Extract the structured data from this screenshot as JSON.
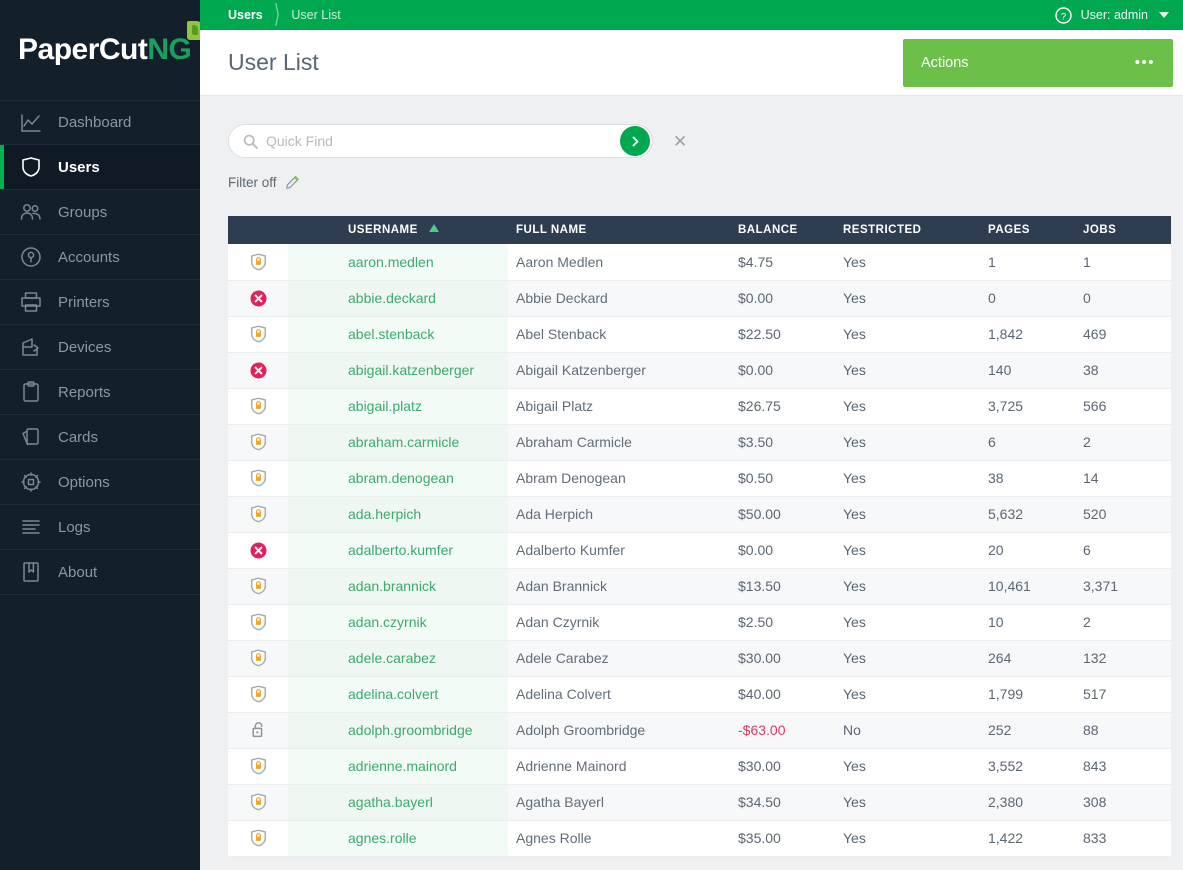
{
  "brand": {
    "name_primary": "PaperCut",
    "name_suffix": "NG",
    "accent_green": "#00a94f",
    "sidebar_bg": "#141f2c"
  },
  "sidebar": {
    "items": [
      {
        "label": "Dashboard",
        "icon": "chart-line-icon",
        "active": false
      },
      {
        "label": "Users",
        "icon": "shield-icon",
        "active": true
      },
      {
        "label": "Groups",
        "icon": "people-icon",
        "active": false
      },
      {
        "label": "Accounts",
        "icon": "lock-circle-icon",
        "active": false
      },
      {
        "label": "Printers",
        "icon": "printer-icon",
        "active": false
      },
      {
        "label": "Devices",
        "icon": "device-icon",
        "active": false
      },
      {
        "label": "Reports",
        "icon": "clipboard-icon",
        "active": false
      },
      {
        "label": "Cards",
        "icon": "cards-icon",
        "active": false
      },
      {
        "label": "Options",
        "icon": "gear-icon",
        "active": false
      },
      {
        "label": "Logs",
        "icon": "lines-icon",
        "active": false
      },
      {
        "label": "About",
        "icon": "book-icon",
        "active": false
      }
    ]
  },
  "topbar": {
    "breadcrumb_current": "Users",
    "breadcrumb_sub": "User List",
    "help_icon": "help-circle-icon",
    "user_label": "User: admin",
    "caret_icon": "chevron-down-icon"
  },
  "header": {
    "page_title": "User List",
    "actions_label": "Actions",
    "actions_dots": "•••",
    "actions_color": "#6cc04a"
  },
  "search": {
    "placeholder": "Quick Find",
    "value": "",
    "go_icon": "chevron-right-icon",
    "clear_icon": "close-icon",
    "filter_label": "Filter off",
    "filter_edit_icon": "pencil-icon"
  },
  "table": {
    "columns": [
      {
        "key": "status",
        "label": ""
      },
      {
        "key": "username",
        "label": "USERNAME",
        "sorted": "asc"
      },
      {
        "key": "fullname",
        "label": "FULL NAME"
      },
      {
        "key": "balance",
        "label": "BALANCE"
      },
      {
        "key": "restricted",
        "label": "RESTRICTED"
      },
      {
        "key": "pages",
        "label": "PAGES"
      },
      {
        "key": "jobs",
        "label": "JOBS"
      }
    ],
    "rows": [
      {
        "status": "shield-lock-icon",
        "username": "aaron.medlen",
        "fullname": "Aaron Medlen",
        "balance": "$4.75",
        "balance_negative": false,
        "restricted": "Yes",
        "pages": "1",
        "jobs": "1"
      },
      {
        "status": "error-circle-icon",
        "username": "abbie.deckard",
        "fullname": "Abbie Deckard",
        "balance": "$0.00",
        "balance_negative": false,
        "restricted": "Yes",
        "pages": "0",
        "jobs": "0"
      },
      {
        "status": "shield-lock-icon",
        "username": "abel.stenback",
        "fullname": "Abel Stenback",
        "balance": "$22.50",
        "balance_negative": false,
        "restricted": "Yes",
        "pages": "1,842",
        "jobs": "469"
      },
      {
        "status": "error-circle-icon",
        "username": "abigail.katzenberger",
        "fullname": "Abigail Katzenberger",
        "balance": "$0.00",
        "balance_negative": false,
        "restricted": "Yes",
        "pages": "140",
        "jobs": "38"
      },
      {
        "status": "shield-lock-icon",
        "username": "abigail.platz",
        "fullname": "Abigail Platz",
        "balance": "$26.75",
        "balance_negative": false,
        "restricted": "Yes",
        "pages": "3,725",
        "jobs": "566"
      },
      {
        "status": "shield-lock-icon",
        "username": "abraham.carmicle",
        "fullname": "Abraham Carmicle",
        "balance": "$3.50",
        "balance_negative": false,
        "restricted": "Yes",
        "pages": "6",
        "jobs": "2"
      },
      {
        "status": "shield-lock-icon",
        "username": "abram.denogean",
        "fullname": "Abram Denogean",
        "balance": "$0.50",
        "balance_negative": false,
        "restricted": "Yes",
        "pages": "38",
        "jobs": "14"
      },
      {
        "status": "shield-lock-icon",
        "username": "ada.herpich",
        "fullname": "Ada Herpich",
        "balance": "$50.00",
        "balance_negative": false,
        "restricted": "Yes",
        "pages": "5,632",
        "jobs": "520"
      },
      {
        "status": "error-circle-icon",
        "username": "adalberto.kumfer",
        "fullname": "Adalberto Kumfer",
        "balance": "$0.00",
        "balance_negative": false,
        "restricted": "Yes",
        "pages": "20",
        "jobs": "6"
      },
      {
        "status": "shield-lock-icon",
        "username": "adan.brannick",
        "fullname": "Adan Brannick",
        "balance": "$13.50",
        "balance_negative": false,
        "restricted": "Yes",
        "pages": "10,461",
        "jobs": "3,371"
      },
      {
        "status": "shield-lock-icon",
        "username": "adan.czyrnik",
        "fullname": "Adan Czyrnik",
        "balance": "$2.50",
        "balance_negative": false,
        "restricted": "Yes",
        "pages": "10",
        "jobs": "2"
      },
      {
        "status": "shield-lock-icon",
        "username": "adele.carabez",
        "fullname": "Adele Carabez",
        "balance": "$30.00",
        "balance_negative": false,
        "restricted": "Yes",
        "pages": "264",
        "jobs": "132"
      },
      {
        "status": "shield-lock-icon",
        "username": "adelina.colvert",
        "fullname": "Adelina Colvert",
        "balance": "$40.00",
        "balance_negative": false,
        "restricted": "Yes",
        "pages": "1,799",
        "jobs": "517"
      },
      {
        "status": "unlock-icon",
        "username": "adolph.groombridge",
        "fullname": "Adolph Groombridge",
        "balance": "-$63.00",
        "balance_negative": true,
        "restricted": "No",
        "pages": "252",
        "jobs": "88"
      },
      {
        "status": "shield-lock-icon",
        "username": "adrienne.mainord",
        "fullname": "Adrienne Mainord",
        "balance": "$30.00",
        "balance_negative": false,
        "restricted": "Yes",
        "pages": "3,552",
        "jobs": "843"
      },
      {
        "status": "shield-lock-icon",
        "username": "agatha.bayerl",
        "fullname": "Agatha Bayerl",
        "balance": "$34.50",
        "balance_negative": false,
        "restricted": "Yes",
        "pages": "2,380",
        "jobs": "308"
      },
      {
        "status": "shield-lock-icon",
        "username": "agnes.rolle",
        "fullname": "Agnes Rolle",
        "balance": "$35.00",
        "balance_negative": false,
        "restricted": "Yes",
        "pages": "1,422",
        "jobs": "833"
      }
    ]
  }
}
